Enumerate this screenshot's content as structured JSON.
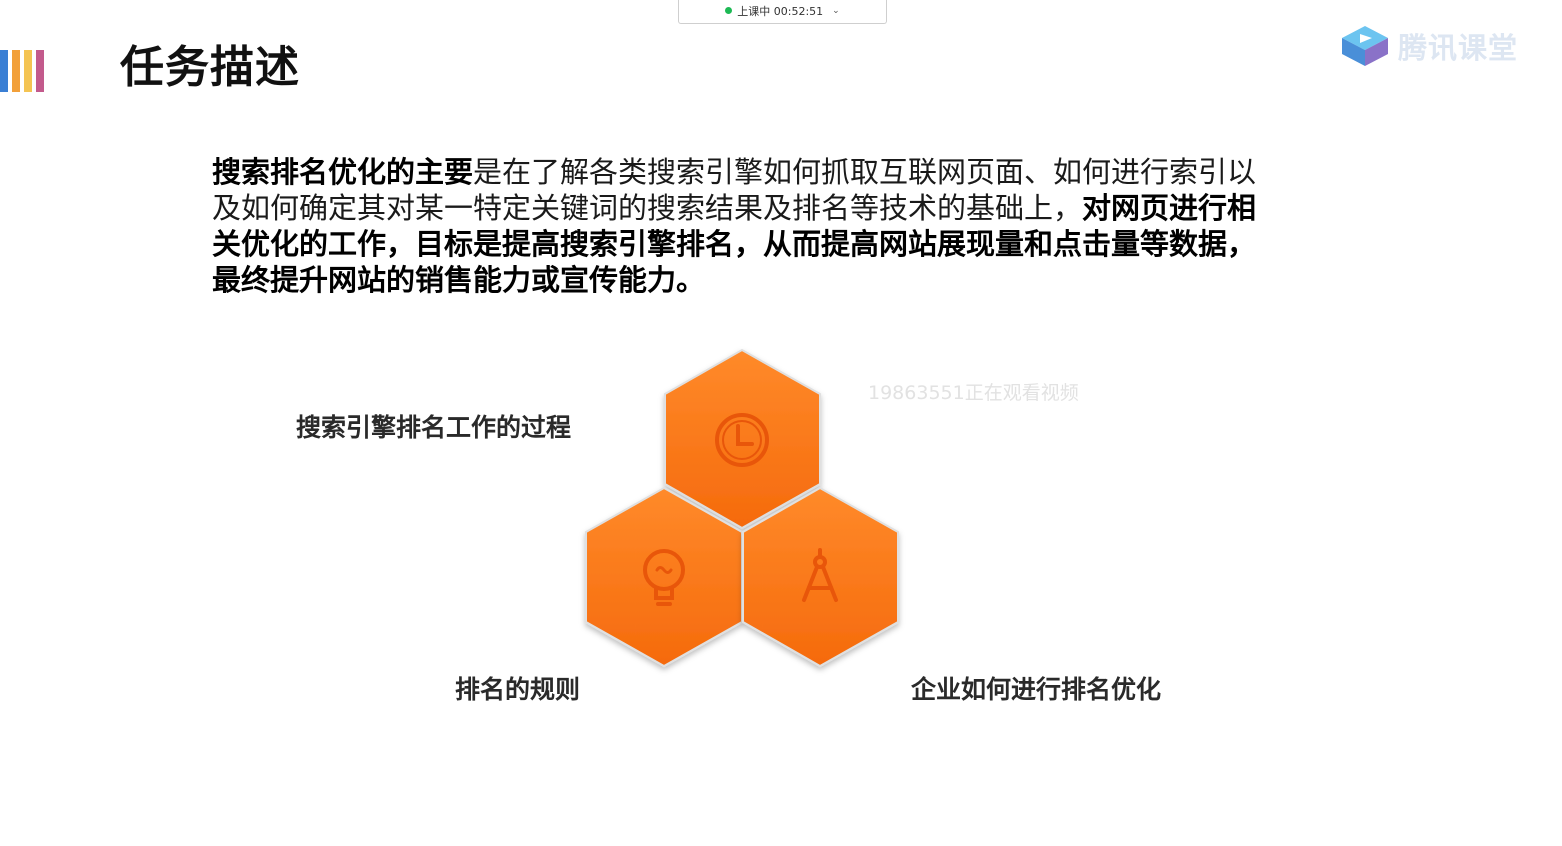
{
  "status_bar": {
    "text": "上课中 00:52:51",
    "dot_color": "#1db954",
    "chevron_icon": "chevron-down-icon"
  },
  "header": {
    "title": "任务描述",
    "accent_colors": [
      "#3a7fd4",
      "#f2a03a",
      "#f4c453",
      "#c35a8c"
    ]
  },
  "brand": {
    "name": "腾讯课堂",
    "icon": "play-cube-icon"
  },
  "description": {
    "seg1_bold": "搜索排名优化的主要",
    "seg2": "是在了解各类搜索引擎如何抓取互联网页面、如何进行索引以及如何确定其对某一特定关键词的搜索结果及排名等技术的基础上，",
    "seg3_bold": "对网页进行相关优化的工作，目标是提高搜索引擎排名，从而提高网站展现量和点击量等数据，最终提升网站的销售能力或宣传能力。"
  },
  "watermark": "19863551正在观看视频",
  "topics": [
    {
      "label": "搜索引擎排名工作的过程",
      "icon": "clock-icon"
    },
    {
      "label": "排名的规则",
      "icon": "lightbulb-icon"
    },
    {
      "label": "企业如何进行排名优化",
      "icon": "compass-icon"
    }
  ],
  "colors": {
    "hex_orange": "#ff7a1a",
    "hex_orange_dark": "#f0620a"
  }
}
